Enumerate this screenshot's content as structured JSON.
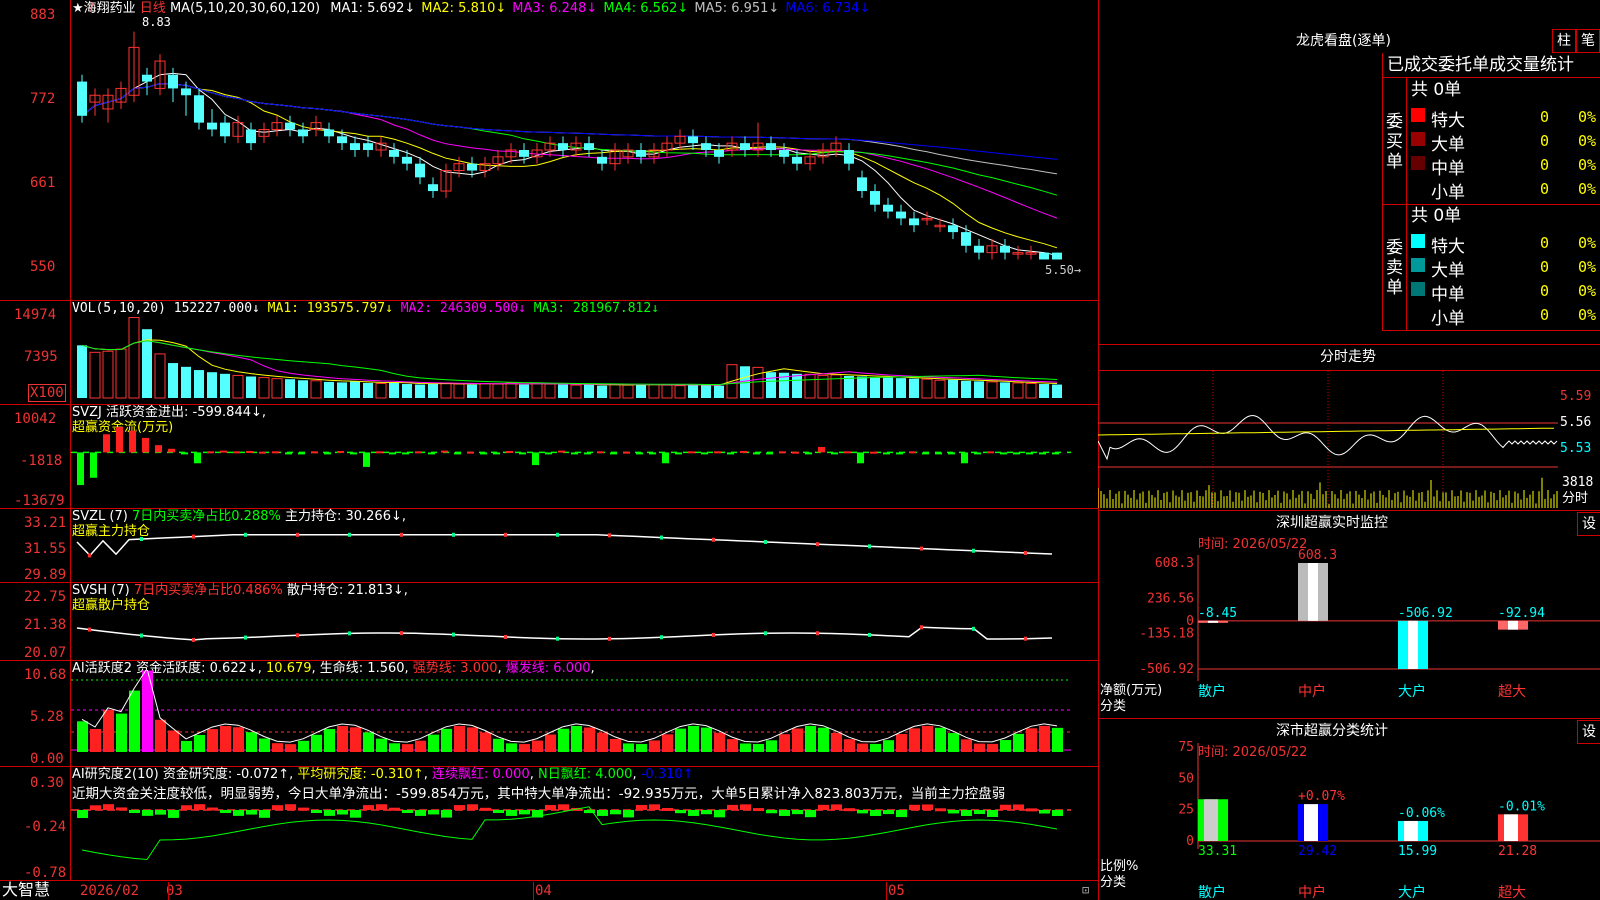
{
  "stock": {
    "title": "★海翔药业",
    "period": "日线",
    "ma_header": "MA(5,10,20,30,60,120)",
    "ma": [
      {
        "label": "MA1:",
        "value": "5.692↓",
        "color": "#ffffff"
      },
      {
        "label": "MA2:",
        "value": "5.810↓",
        "color": "#ffff00"
      },
      {
        "label": "MA3:",
        "value": "6.248↓",
        "color": "#ff00ff"
      },
      {
        "label": "MA4:",
        "value": "6.562↓",
        "color": "#00ff00"
      },
      {
        "label": "MA5:",
        "value": "6.951↓",
        "color": "#c0c0c0"
      },
      {
        "label": "MA6:",
        "value": "6.734↓",
        "color": "#0000ff"
      }
    ],
    "high_mark": "8.83",
    "low_mark": "5.50",
    "corner_marker": "?",
    "price_axis": [
      "883",
      "772",
      "661",
      "550"
    ]
  },
  "volume": {
    "header": "VOL(5,10,20)",
    "value": "152227.000↓",
    "ma1": "MA1: 193575.797↓",
    "ma2": "MA2: 246309.500↓",
    "ma3": "MA3: 281967.812↓",
    "axis": [
      "14974",
      "7395",
      "X100"
    ]
  },
  "svzj": {
    "name": "SVZJ",
    "label": "活跃资金进出: -599.844↓,",
    "subtitle": "超赢资金流(万元)",
    "axis": [
      "10042",
      "-1818",
      "-13679"
    ]
  },
  "svzl": {
    "name": "SVZL (7)",
    "ratio": "7日内买卖净占比0.288%",
    "hold": "主力持仓: 30.266↓,",
    "subtitle": "超赢主力持仓",
    "axis": [
      "33.21",
      "31.55",
      "29.89"
    ]
  },
  "svsh": {
    "name": "SVSH (7)",
    "ratio": "7日内买卖净占比0.486%",
    "hold": "散户持仓: 21.813↓,",
    "subtitle": "超赢散户持仓",
    "axis": [
      "22.75",
      "21.38",
      "20.07"
    ]
  },
  "ai_active": {
    "name": "AI活跃度2",
    "v1": "资金活跃度: 0.622↓",
    "v2": "10.679",
    "v3": "生命线: 1.560",
    "v4": "强势线: 3.000",
    "v5": "爆发线: 6.000",
    "axis": [
      "10.68",
      "5.28",
      "0.00"
    ]
  },
  "ai_research": {
    "name": "AI研究度2(10)",
    "v1": "资金研究度: -0.072↑",
    "v2": "平均研究度: -0.310↑",
    "v3": "连续飘红: 0.000",
    "v4": "N日飘红: 4.000",
    "v5": "-0.310↑",
    "comment": "近期大资金关注度较低，明显弱势，今日大单净流出：-599.854万元，其中特大单净流出：-92.935万元，大单5日累计净入823.803万元，当前主力控盘弱",
    "axis": [
      "0.30",
      "-0.24",
      "-0.78"
    ]
  },
  "bottom_axis": {
    "app_name": "大智慧",
    "dates": [
      "2026/02",
      "03",
      "04",
      "05"
    ]
  },
  "dragon": {
    "title": "龙虎看盘(逐单)",
    "btn_zhu": "柱",
    "btn_bi": "笔",
    "tabs": [
      "已成交",
      "委托单",
      "成交量统计"
    ],
    "buy_label": "委买单",
    "sell_label": "委卖单",
    "buy_total": "共 0单",
    "sell_total": "共 0单",
    "buy_rows": [
      {
        "name": "特大",
        "count": "0",
        "pct": "0%",
        "color": "#ff0000"
      },
      {
        "name": "大单",
        "count": "0",
        "pct": "0%",
        "color": "#990000"
      },
      {
        "name": "中单",
        "count": "0",
        "pct": "0%",
        "color": "#660000"
      },
      {
        "name": "小单",
        "count": "0",
        "pct": "0%",
        "color": ""
      }
    ],
    "sell_rows": [
      {
        "name": "特大",
        "count": "0",
        "pct": "0%",
        "color": "#00ffff"
      },
      {
        "name": "大单",
        "count": "0",
        "pct": "0%",
        "color": "#009999"
      },
      {
        "name": "中单",
        "count": "0",
        "pct": "0%",
        "color": "#007777"
      },
      {
        "name": "小单",
        "count": "0",
        "pct": "0%",
        "color": ""
      }
    ]
  },
  "intraday": {
    "title": "分时走势",
    "axis": [
      "5.59",
      "5.56",
      "5.53"
    ],
    "vol_value": "3818",
    "vol_label": "分时"
  },
  "sz_monitor": {
    "title": "深圳超赢实时监控",
    "btn": "设",
    "time": "时间: 2026/05/22",
    "axis": [
      "608.3",
      "236.56",
      "0",
      "-135.18",
      "-506.92"
    ],
    "left_label_1": "净额(万元)",
    "left_label_2": "分类",
    "categories": [
      "散户",
      "中户",
      "大户",
      "超大"
    ],
    "values_text": [
      "-8.45",
      "608.3",
      "-506.92",
      "-92.94"
    ]
  },
  "sz_class": {
    "title": "深市超赢分类统计",
    "btn": "设",
    "time": "时间: 2026/05/22",
    "axis": [
      "75",
      "50",
      "25",
      "0"
    ],
    "left_label_1": "比例%",
    "left_label_2": "分类",
    "categories": [
      "散户",
      "中户",
      "大户",
      "超大"
    ],
    "values_text": [
      "33.31",
      "29.42",
      "15.99",
      "21.28"
    ],
    "change_text": [
      "+0.07%",
      "-0.06%",
      "-0.01%"
    ]
  },
  "chart_data": [
    {
      "type": "candlestick",
      "name": "海翔药业 日线",
      "ylim": [
        5.2,
        9.0
      ],
      "candles": [
        [
          8.1,
          7.6,
          8.2,
          7.5
        ],
        [
          7.8,
          7.9,
          8.0,
          7.6
        ],
        [
          7.7,
          7.9,
          8.0,
          7.5
        ],
        [
          7.8,
          8.0,
          8.1,
          7.7
        ],
        [
          7.9,
          8.6,
          8.83,
          7.8
        ],
        [
          8.2,
          8.1,
          8.3,
          7.9
        ],
        [
          8.0,
          8.4,
          8.5,
          7.9
        ],
        [
          8.2,
          8.0,
          8.3,
          7.8
        ],
        [
          8.0,
          7.9,
          8.1,
          7.6
        ],
        [
          7.9,
          7.5,
          8.0,
          7.4
        ],
        [
          7.5,
          7.4,
          7.7,
          7.3
        ],
        [
          7.5,
          7.3,
          7.6,
          7.2
        ],
        [
          7.3,
          7.5,
          7.6,
          7.2
        ],
        [
          7.4,
          7.2,
          7.5,
          7.1
        ],
        [
          7.3,
          7.4,
          7.5,
          7.2
        ],
        [
          7.4,
          7.5,
          7.6,
          7.3
        ],
        [
          7.5,
          7.4,
          7.6,
          7.3
        ],
        [
          7.4,
          7.3,
          7.5,
          7.2
        ],
        [
          7.4,
          7.5,
          7.6,
          7.3
        ],
        [
          7.4,
          7.3,
          7.5,
          7.2
        ],
        [
          7.3,
          7.2,
          7.4,
          7.1
        ],
        [
          7.2,
          7.1,
          7.3,
          7.0
        ],
        [
          7.2,
          7.1,
          7.3,
          7.0
        ],
        [
          7.1,
          7.2,
          7.3,
          7.0
        ],
        [
          7.1,
          7.0,
          7.2,
          6.9
        ],
        [
          7.0,
          6.9,
          7.1,
          6.8
        ],
        [
          6.9,
          6.7,
          7.0,
          6.6
        ],
        [
          6.6,
          6.5,
          6.7,
          6.4
        ],
        [
          6.5,
          6.8,
          6.9,
          6.4
        ],
        [
          6.8,
          6.9,
          7.0,
          6.7
        ],
        [
          6.9,
          6.8,
          7.0,
          6.7
        ],
        [
          6.8,
          6.9,
          7.0,
          6.7
        ],
        [
          6.9,
          7.0,
          7.1,
          6.8
        ],
        [
          7.0,
          7.1,
          7.2,
          6.9
        ],
        [
          7.1,
          7.0,
          7.2,
          6.9
        ],
        [
          7.0,
          7.1,
          7.2,
          6.9
        ],
        [
          7.1,
          7.2,
          7.3,
          7.0
        ],
        [
          7.2,
          7.1,
          7.3,
          7.0
        ],
        [
          7.1,
          7.2,
          7.3,
          7.0
        ],
        [
          7.2,
          7.1,
          7.3,
          7.0
        ],
        [
          7.0,
          6.9,
          7.1,
          6.8
        ],
        [
          6.9,
          7.1,
          7.2,
          6.8
        ],
        [
          7.0,
          7.1,
          7.2,
          6.9
        ],
        [
          7.1,
          7.0,
          7.2,
          6.9
        ],
        [
          7.0,
          7.1,
          7.2,
          6.9
        ],
        [
          7.1,
          7.2,
          7.3,
          7.0
        ],
        [
          7.2,
          7.3,
          7.4,
          7.1
        ],
        [
          7.3,
          7.2,
          7.4,
          7.1
        ],
        [
          7.2,
          7.1,
          7.3,
          7.0
        ],
        [
          7.1,
          7.0,
          7.2,
          6.9
        ],
        [
          7.1,
          7.2,
          7.3,
          7.0
        ],
        [
          7.2,
          7.1,
          7.3,
          7.0
        ],
        [
          7.1,
          7.2,
          7.5,
          7.0
        ],
        [
          7.2,
          7.1,
          7.3,
          7.0
        ],
        [
          7.1,
          7.0,
          7.2,
          6.9
        ],
        [
          7.0,
          6.9,
          7.1,
          6.8
        ],
        [
          6.9,
          7.0,
          7.1,
          6.8
        ],
        [
          7.0,
          7.1,
          7.2,
          6.9
        ],
        [
          7.1,
          7.2,
          7.3,
          7.0
        ],
        [
          7.1,
          6.9,
          7.2,
          6.8
        ],
        [
          6.7,
          6.5,
          6.8,
          6.4
        ],
        [
          6.5,
          6.3,
          6.6,
          6.2
        ],
        [
          6.3,
          6.2,
          6.4,
          6.1
        ],
        [
          6.2,
          6.1,
          6.3,
          6.0
        ],
        [
          6.1,
          6.0,
          6.2,
          5.9
        ],
        [
          6.1,
          6.1,
          6.2,
          6.0
        ],
        [
          6.0,
          6.0,
          6.1,
          5.9
        ],
        [
          6.0,
          5.9,
          6.1,
          5.8
        ],
        [
          5.9,
          5.7,
          6.0,
          5.6
        ],
        [
          5.7,
          5.6,
          5.8,
          5.5
        ],
        [
          5.6,
          5.7,
          5.8,
          5.5
        ],
        [
          5.7,
          5.6,
          5.8,
          5.5
        ],
        [
          5.6,
          5.6,
          5.7,
          5.5
        ],
        [
          5.6,
          5.6,
          5.7,
          5.5
        ],
        [
          5.6,
          5.5,
          5.6,
          5.5
        ],
        [
          5.6,
          5.5,
          5.6,
          5.5
        ]
      ]
    },
    {
      "type": "bar",
      "name": "VOL",
      "ylim": [
        0,
        16000
      ],
      "values": [
        9800,
        8500,
        8700,
        9100,
        14974,
        12800,
        8200,
        6500,
        5800,
        5200,
        4800,
        4500,
        4200,
        4000,
        3800,
        3600,
        3500,
        3300,
        3200,
        3000,
        2900,
        3100,
        2800,
        2700,
        2900,
        2600,
        2500,
        2700,
        2800,
        2600,
        2500,
        2700,
        2600,
        2800,
        2500,
        2700,
        2600,
        2500,
        2400,
        2600,
        2300,
        2500,
        2400,
        2600,
        2500,
        2400,
        2300,
        2500,
        2400,
        2300,
        6200,
        5900,
        5700,
        4800,
        4700,
        4500,
        4400,
        4200,
        4300,
        4100,
        4000,
        3900,
        3800,
        3700,
        3600,
        3500,
        3300,
        3400,
        3200,
        3100,
        3000,
        2900,
        2800,
        2700,
        2600,
        2500
      ]
    },
    {
      "type": "bar",
      "name": "超赢资金流(万元)",
      "ylim": [
        -13679,
        10042
      ],
      "values": [
        -9000,
        -7000,
        5000,
        7000,
        6000,
        4000,
        2000,
        1000,
        -500,
        -3000,
        300,
        500,
        300,
        400,
        200,
        300,
        -500,
        -200,
        300,
        -200,
        400,
        -300,
        -4000,
        300,
        -200,
        -300,
        300,
        -200,
        500,
        -300,
        200,
        -300,
        -200,
        400,
        -300,
        -3500,
        -200,
        500,
        -300,
        -200,
        300,
        -300,
        200,
        -300,
        -400,
        -3000,
        -300,
        300,
        -200,
        300,
        -200,
        400,
        -300,
        -200,
        300,
        200,
        -300,
        1500,
        -200,
        300,
        -3000,
        200,
        -300,
        -200,
        300,
        -300,
        -200,
        -300,
        -3000,
        -200,
        300,
        -300,
        -200,
        -300,
        -200,
        -300
      ]
    }
  ]
}
